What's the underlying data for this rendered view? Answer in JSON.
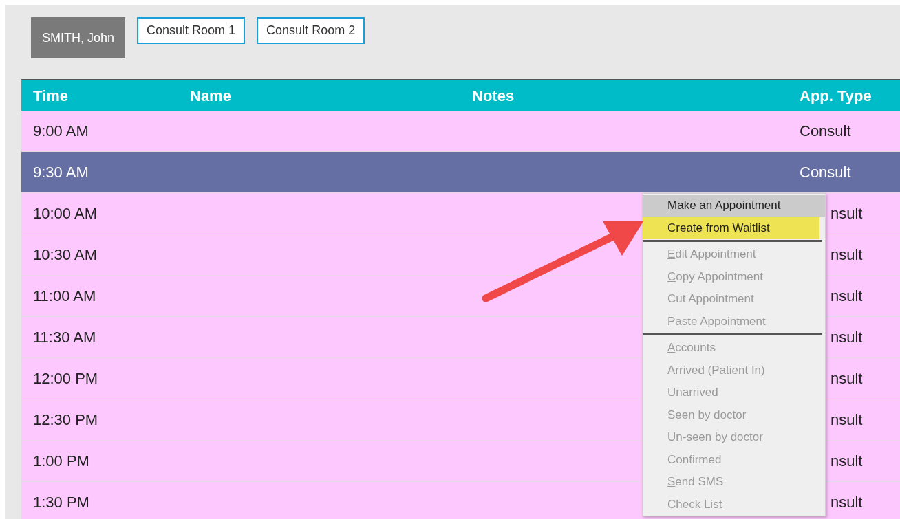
{
  "practitioner_tabs": [
    {
      "label": "SMITH, John",
      "selected": true
    },
    {
      "label": "Consult Room 1",
      "selected": false
    },
    {
      "label": "Consult Room 2",
      "selected": false
    }
  ],
  "table": {
    "columns": [
      "Time",
      "Name",
      "Notes",
      "App. Type"
    ],
    "rows": [
      {
        "time": "9:00 AM",
        "app_type": "Consult",
        "selected": false,
        "covered": false
      },
      {
        "time": "9:30 AM",
        "app_type": "Consult",
        "selected": true,
        "covered": false
      },
      {
        "time": "10:00 AM",
        "app_type": "nsult",
        "selected": false,
        "covered": true
      },
      {
        "time": "10:30 AM",
        "app_type": "nsult",
        "selected": false,
        "covered": true
      },
      {
        "time": "11:00 AM",
        "app_type": "nsult",
        "selected": false,
        "covered": true
      },
      {
        "time": "11:30 AM",
        "app_type": "nsult",
        "selected": false,
        "covered": true
      },
      {
        "time": "12:00 PM",
        "app_type": "nsult",
        "selected": false,
        "covered": true
      },
      {
        "time": "12:30 PM",
        "app_type": "nsult",
        "selected": false,
        "covered": true
      },
      {
        "time": "1:00 PM",
        "app_type": "nsult",
        "selected": false,
        "covered": true
      },
      {
        "time": "1:30 PM",
        "app_type": "nsult",
        "selected": false,
        "covered": true
      }
    ]
  },
  "context_menu": [
    {
      "kind": "item",
      "label": {
        "key": "M",
        "after": "ake an Appointment"
      },
      "disabled": false,
      "selected": false,
      "default": true
    },
    {
      "kind": "item",
      "label": {
        "after": "Create from Waitlist"
      },
      "disabled": false,
      "selected": true,
      "default": false
    },
    {
      "kind": "separator"
    },
    {
      "kind": "item",
      "label": {
        "key": "E",
        "after": "dit Appointment"
      },
      "disabled": true,
      "selected": false,
      "default": false
    },
    {
      "kind": "item",
      "label": {
        "key": "C",
        "after": "opy Appointment"
      },
      "disabled": true,
      "selected": false,
      "default": false
    },
    {
      "kind": "item",
      "label": {
        "after": "Cut Appointment"
      },
      "disabled": true,
      "selected": false,
      "default": false
    },
    {
      "kind": "item",
      "label": {
        "after": "Paste Appointment"
      },
      "disabled": true,
      "selected": false,
      "default": false
    },
    {
      "kind": "separator"
    },
    {
      "kind": "item",
      "label": {
        "key": "A",
        "after": "ccounts"
      },
      "disabled": true,
      "selected": false,
      "default": false
    },
    {
      "kind": "item",
      "label": {
        "before": "Arr",
        "key": "i",
        "after": "ved (Patient In)"
      },
      "disabled": true,
      "selected": false,
      "default": false
    },
    {
      "kind": "item",
      "label": {
        "after": "Unarrived"
      },
      "disabled": true,
      "selected": false,
      "default": false
    },
    {
      "kind": "item",
      "label": {
        "after": "Seen by doctor"
      },
      "disabled": true,
      "selected": false,
      "default": false
    },
    {
      "kind": "item",
      "label": {
        "after": "Un-seen by doctor"
      },
      "disabled": true,
      "selected": false,
      "default": false
    },
    {
      "kind": "item",
      "label": {
        "after": "Confirmed"
      },
      "disabled": true,
      "selected": false,
      "default": false
    },
    {
      "kind": "item",
      "label": {
        "key": "S",
        "after": "end SMS"
      },
      "disabled": true,
      "selected": false,
      "default": false
    },
    {
      "kind": "item",
      "label": {
        "after": "Check List"
      },
      "disabled": true,
      "selected": false,
      "default": false
    }
  ]
}
